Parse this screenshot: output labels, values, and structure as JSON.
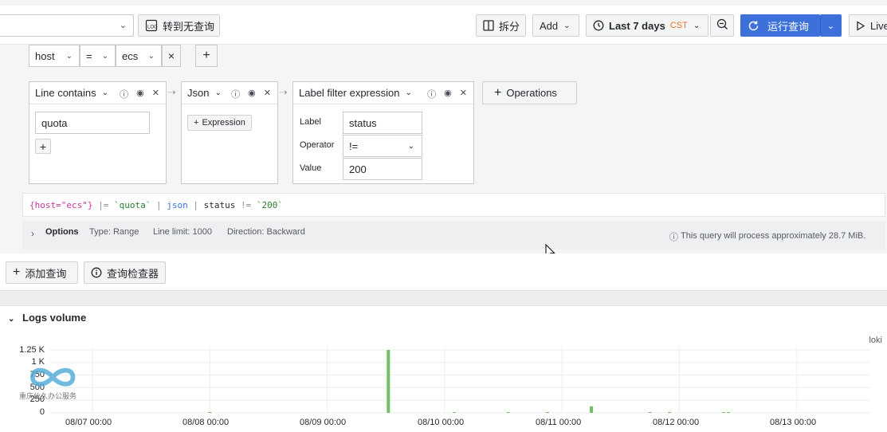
{
  "toolbar": {
    "datasource_value": "",
    "switch_label": "转到无查询",
    "split_label": "拆分",
    "add_label": "Add",
    "time_range": "Last 7 days",
    "timezone": "CST",
    "run_label": "运行查询",
    "live_label": "Live"
  },
  "label_filter": {
    "label": "host",
    "operator": "=",
    "value": "ecs"
  },
  "operations": [
    {
      "title": "Line contains",
      "value": "quota"
    },
    {
      "title": "Json",
      "add_label": "Expression"
    },
    {
      "title": "Label filter expression",
      "label_caption": "Label",
      "label_value": "status",
      "operator_caption": "Operator",
      "operator_value": "!=",
      "value_caption": "Value",
      "value_value": "200"
    }
  ],
  "operations_button": "Operations",
  "query": {
    "p1": "{host=\"ecs\"}",
    "p2": " |= ",
    "p3": "`quota`",
    "p4": " | ",
    "p5": "json",
    "p6": " | ",
    "p7": "status",
    "p8": " != ",
    "p9": "`200`"
  },
  "options": {
    "label": "Options",
    "type": "Type: Range",
    "limit": "Line limit: 1000",
    "direction": "Direction: Backward",
    "estimate": "This query will process approximately 28.7 MiB."
  },
  "actions": {
    "add_query": "添加查询",
    "inspector": "查询检查器"
  },
  "logs_volume": {
    "title": "Logs volume",
    "legend": "loki",
    "y_ticks": [
      "1.25 K",
      "1 K",
      "750",
      "500",
      "250",
      "0"
    ],
    "x_ticks": [
      "08/07 00:00",
      "08/08 00:00",
      "08/09 00:00",
      "08/10 00:00",
      "08/11 00:00",
      "08/12 00:00",
      "08/13 00:00"
    ]
  },
  "watermark_text": "重庆伙久办公服务",
  "colors": {
    "primary": "#3d71d9",
    "bar": "#73bf69",
    "cst": "#e8752b"
  },
  "chart_data": {
    "type": "bar",
    "title": "Logs volume",
    "ylim": [
      0,
      1250
    ],
    "series": [
      {
        "name": "loki",
        "points": [
          {
            "x": "08/08 00:00",
            "y": 5
          },
          {
            "x": "08/09 12:30",
            "y": 1250
          },
          {
            "x": "08/10 02:00",
            "y": 8
          },
          {
            "x": "08/10 13:00",
            "y": 10
          },
          {
            "x": "08/10 21:00",
            "y": 12
          },
          {
            "x": "08/11 06:00",
            "y": 130
          },
          {
            "x": "08/11 18:00",
            "y": 8
          },
          {
            "x": "08/11 22:00",
            "y": 8
          },
          {
            "x": "08/12 09:00",
            "y": 15
          },
          {
            "x": "08/12 10:00",
            "y": 15
          }
        ]
      }
    ]
  }
}
